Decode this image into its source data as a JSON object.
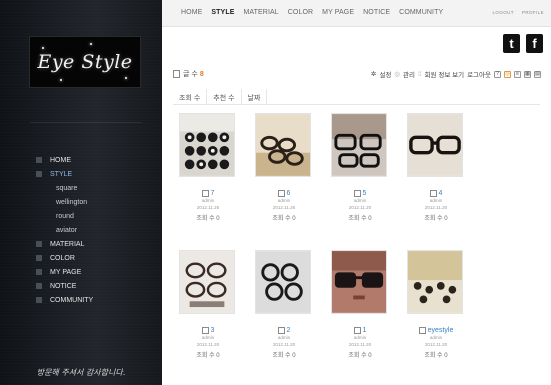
{
  "sidebar": {
    "logo_text": "Eye Style",
    "nav": [
      {
        "label": "HOME",
        "sub": false,
        "active": false
      },
      {
        "label": "STYLE",
        "sub": false,
        "active": true
      },
      {
        "label": "square",
        "sub": true,
        "active": false
      },
      {
        "label": "wellington",
        "sub": true,
        "active": false
      },
      {
        "label": "round",
        "sub": true,
        "active": false
      },
      {
        "label": "aviator",
        "sub": true,
        "active": false
      },
      {
        "label": "MATERIAL",
        "sub": false,
        "active": false
      },
      {
        "label": "COLOR",
        "sub": false,
        "active": false
      },
      {
        "label": "MY PAGE",
        "sub": false,
        "active": false
      },
      {
        "label": "NOTICE",
        "sub": false,
        "active": false
      },
      {
        "label": "COMMUNITY",
        "sub": false,
        "active": false
      }
    ],
    "tagline": "방문해 주셔서 감사합니다."
  },
  "topbar": {
    "nav": [
      "HOME",
      "STYLE",
      "MATERIAL",
      "COLOR",
      "MY PAGE",
      "NOTICE",
      "COMMUNITY"
    ],
    "active": "STYLE",
    "logout": "LOGOUT",
    "profile": "PROFILE"
  },
  "social": {
    "twitter": "t",
    "facebook": "f"
  },
  "board": {
    "count_label": "글 수",
    "count_value": "8",
    "toolbar": {
      "settings": "설정",
      "admin": "관리",
      "member_info": "회원 정보 보기",
      "logout": "로그아웃",
      "mini_icons": [
        "?",
        "◎",
        "≡",
        "▦",
        "▤"
      ]
    },
    "sort_tabs": [
      "조회 수",
      "추천 수",
      "날짜"
    ],
    "posts": [
      {
        "no": "7",
        "author": "admin",
        "date": "2012.11.26",
        "views_label": "조회 수",
        "views": "0",
        "photo": "display-stand"
      },
      {
        "no": "6",
        "author": "admin",
        "date": "2012.11.26",
        "views_label": "조회 수",
        "views": "0",
        "photo": "glasses-pile"
      },
      {
        "no": "5",
        "author": "admin",
        "date": "2012.11.20",
        "views_label": "조회 수",
        "views": "0",
        "photo": "black-frames-side"
      },
      {
        "no": "4",
        "author": "admin",
        "date": "2012.11.20",
        "views_label": "조회 수",
        "views": "0",
        "photo": "black-frames-front"
      },
      {
        "no": "3",
        "author": "admin",
        "date": "2012.11.20",
        "views_label": "조회 수",
        "views": "0",
        "photo": "frames-stack"
      },
      {
        "no": "2",
        "author": "admin",
        "date": "2012.11.20",
        "views_label": "조회 수",
        "views": "0",
        "photo": "round-frames"
      },
      {
        "no": "1",
        "author": "admin",
        "date": "2012.11.20",
        "views_label": "조회 수",
        "views": "0",
        "photo": "face-closeup"
      },
      {
        "no": "eyestyle",
        "author": "admin",
        "date": "2012.11.20",
        "views_label": "조회 수",
        "views": "0",
        "photo": "shop-window"
      }
    ]
  },
  "colors": {
    "accent_orange": "#e07a2a",
    "link_blue": "#3a7fc1",
    "sidebar_dark": "#1c2026"
  }
}
